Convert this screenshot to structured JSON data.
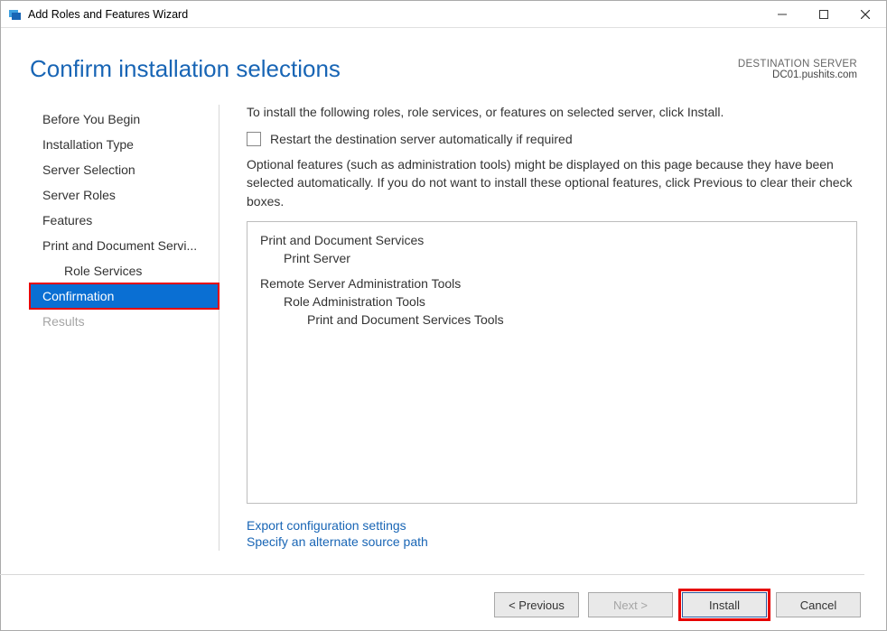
{
  "window": {
    "title": "Add Roles and Features Wizard"
  },
  "header": {
    "page_title": "Confirm installation selections",
    "dest_label": "DESTINATION SERVER",
    "dest_value": "DC01.pushits.com"
  },
  "sidebar": {
    "items": [
      {
        "label": "Before You Begin",
        "indent": false,
        "selected": false,
        "disabled": false
      },
      {
        "label": "Installation Type",
        "indent": false,
        "selected": false,
        "disabled": false
      },
      {
        "label": "Server Selection",
        "indent": false,
        "selected": false,
        "disabled": false
      },
      {
        "label": "Server Roles",
        "indent": false,
        "selected": false,
        "disabled": false
      },
      {
        "label": "Features",
        "indent": false,
        "selected": false,
        "disabled": false
      },
      {
        "label": "Print and Document Servi...",
        "indent": false,
        "selected": false,
        "disabled": false
      },
      {
        "label": "Role Services",
        "indent": true,
        "selected": false,
        "disabled": false
      },
      {
        "label": "Confirmation",
        "indent": false,
        "selected": true,
        "disabled": false
      },
      {
        "label": "Results",
        "indent": false,
        "selected": false,
        "disabled": true
      }
    ]
  },
  "main": {
    "intro": "To install the following roles, role services, or features on selected server, click Install.",
    "restart_label": "Restart the destination server automatically if required",
    "restart_checked": false,
    "optional_text": "Optional features (such as administration tools) might be displayed on this page because they have been selected automatically. If you do not want to install these optional features, click Previous to clear their check boxes.",
    "install_tree": [
      {
        "label": "Print and Document Services",
        "level": 0
      },
      {
        "label": "Print Server",
        "level": 1
      },
      {
        "gap": true
      },
      {
        "label": "Remote Server Administration Tools",
        "level": 0
      },
      {
        "label": "Role Administration Tools",
        "level": 1
      },
      {
        "label": "Print and Document Services Tools",
        "level": 2
      }
    ],
    "links": {
      "export": "Export configuration settings",
      "alt_source": "Specify an alternate source path"
    }
  },
  "buttons": {
    "previous": "< Previous",
    "next": "Next >",
    "install": "Install",
    "cancel": "Cancel"
  }
}
